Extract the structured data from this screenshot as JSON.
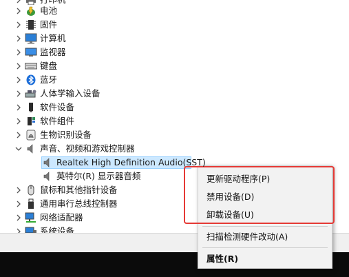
{
  "tree": {
    "items": [
      {
        "label": "打印机",
        "icon": "printer-icon",
        "expanded": false
      },
      {
        "label": "电池",
        "icon": "battery-icon",
        "expanded": false
      },
      {
        "label": "固件",
        "icon": "firmware-icon",
        "expanded": false
      },
      {
        "label": "计算机",
        "icon": "computer-icon",
        "expanded": false
      },
      {
        "label": "监视器",
        "icon": "monitor-icon",
        "expanded": false
      },
      {
        "label": "键盘",
        "icon": "keyboard-icon",
        "expanded": false
      },
      {
        "label": "蓝牙",
        "icon": "bluetooth-icon",
        "expanded": false
      },
      {
        "label": "人体学输入设备",
        "icon": "hid-icon",
        "expanded": false
      },
      {
        "label": "软件设备",
        "icon": "software-device-icon",
        "expanded": false
      },
      {
        "label": "软件组件",
        "icon": "software-component-icon",
        "expanded": false
      },
      {
        "label": "生物识别设备",
        "icon": "fingerprint-icon",
        "expanded": false
      },
      {
        "label": "声音、视频和游戏控制器",
        "icon": "speaker-icon",
        "expanded": true
      },
      {
        "label": "Realtek High Definition Audio(SST)",
        "icon": "speaker-icon",
        "child": true,
        "selected": true
      },
      {
        "label": "英特尔(R) 显示器音频",
        "icon": "speaker-icon",
        "child": true
      },
      {
        "label": "鼠标和其他指针设备",
        "icon": "mouse-icon",
        "expanded": false
      },
      {
        "label": "通用串行总线控制器",
        "icon": "usb-icon",
        "expanded": false
      },
      {
        "label": "网络适配器",
        "icon": "network-icon",
        "expanded": false
      },
      {
        "label": "系统设备",
        "icon": "system-device-icon",
        "expanded": false
      }
    ]
  },
  "context_menu": {
    "update_driver": "更新驱动程序(P)",
    "disable_device": "禁用设备(D)",
    "uninstall_device": "卸载设备(U)",
    "scan_hardware": "扫描检测硬件改动(A)",
    "properties": "属性(R)"
  },
  "colors": {
    "highlight_border": "#e53935",
    "selection_bg": "#cce8ff",
    "taskbar": "#0b0b0b"
  }
}
